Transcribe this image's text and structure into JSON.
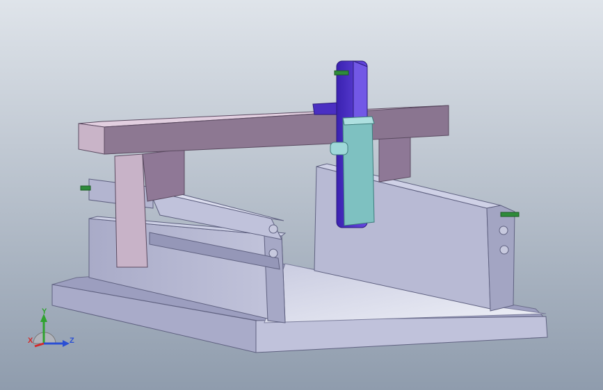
{
  "viewport": {
    "background_top": "#dfe4ea",
    "background_bottom": "#8f9cad"
  },
  "model": {
    "colors": {
      "base_plate": "#b9bbd6",
      "base_plate_side": "#9a9cbc",
      "rail_wall": "#a7a9c7",
      "beam": "#c7aec7",
      "beam_side": "#8f7894",
      "z_column": "#4a2fc2",
      "slider_block": "#7fbfbf",
      "pin": "#2e8b3a"
    }
  },
  "triad": {
    "y_label": "Y",
    "x_label": "X",
    "z_label": "Z",
    "y_color": "#2fa32f",
    "x_color": "#d42a2a",
    "z_color": "#2a4fd4"
  }
}
